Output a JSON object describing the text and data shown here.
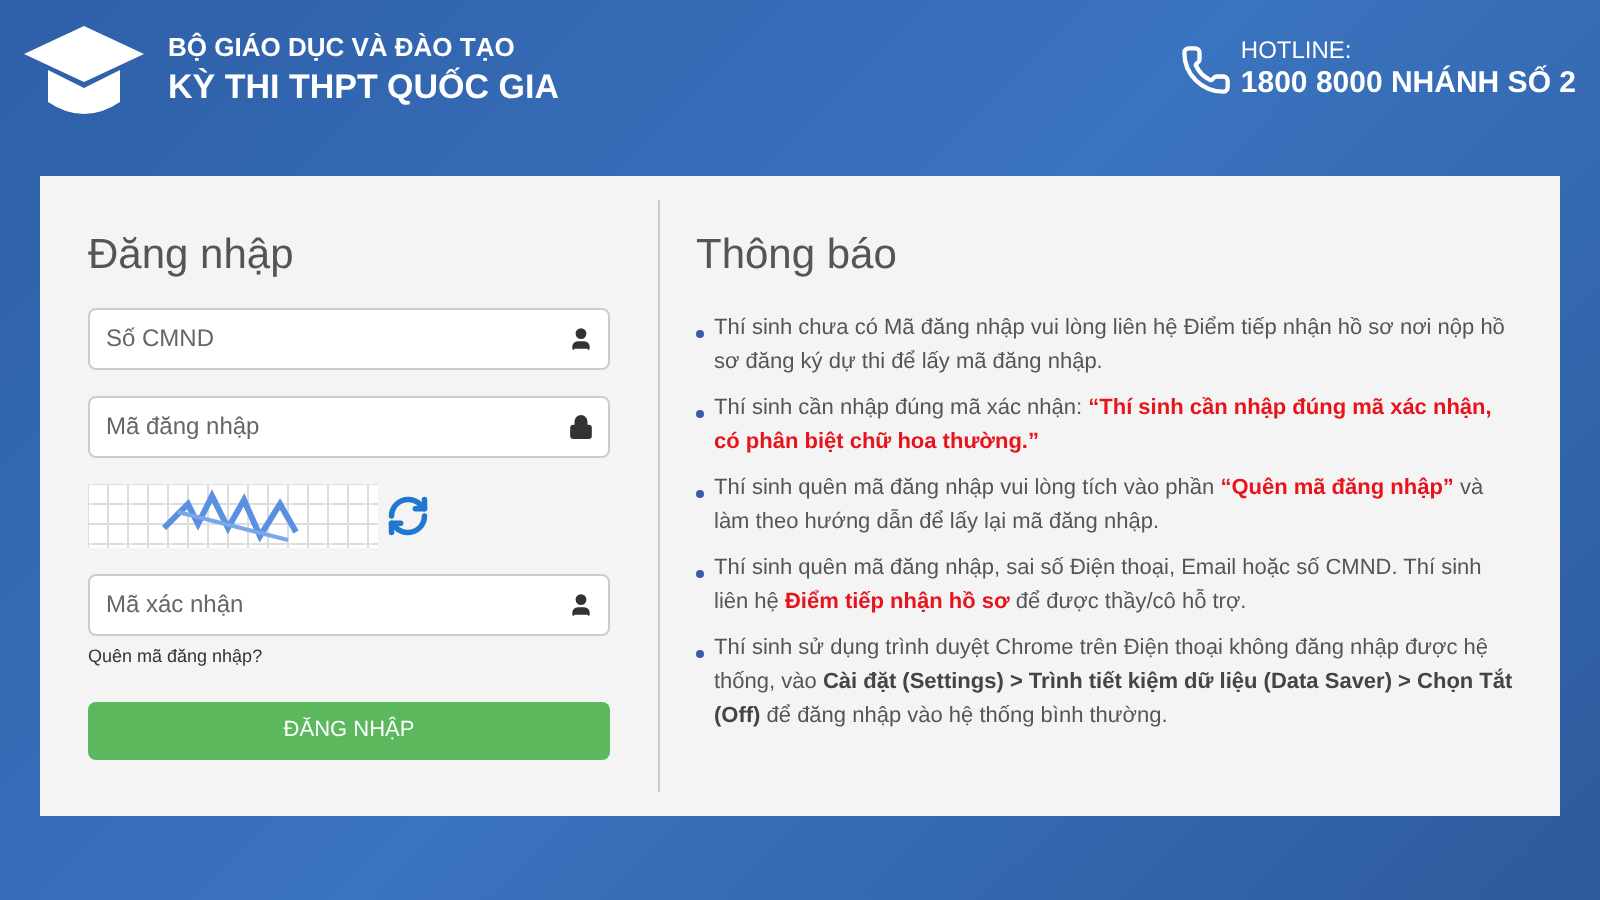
{
  "header": {
    "org": "BỘ GIÁO DỤC VÀ ĐÀO TẠO",
    "title": "KỲ THI THPT QUỐC GIA",
    "hotline_label": "HOTLINE:",
    "hotline_number": "1800 8000 NHÁNH SỐ 2"
  },
  "login": {
    "title": "Đăng nhập",
    "fields": [
      {
        "kind": "account",
        "placeholder": "Số CMND"
      },
      {
        "kind": "password",
        "placeholder": "Mã đăng nhập"
      },
      {
        "kind": "captcha"
      },
      {
        "kind": "account",
        "placeholder": "Mã xác nhận"
      }
    ],
    "forgot_link": "Quên mã đăng nhập?",
    "submit": "ĐĂNG NHẬP"
  },
  "notice": {
    "title": "Thông báo",
    "items": [
      [
        {
          "kind": "plain",
          "text": "Thí sinh chưa có Mã đăng nhập vui lòng liên hệ Điểm tiếp nhận hồ sơ nơi nộp hồ sơ đăng ký dự thi để lấy mã đăng nhập."
        }
      ],
      [
        {
          "kind": "plain",
          "text": "Thí sinh cần nhập đúng mã xác nhận: "
        },
        {
          "kind": "highlight",
          "text": "“Thí sinh cần nhập đúng mã xác nhận, có phân biệt chữ hoa thường.”"
        }
      ],
      [
        {
          "kind": "plain",
          "text": "Thí sinh quên mã đăng nhập vui lòng tích vào phần "
        },
        {
          "kind": "highlight",
          "text": "“Quên mã đăng nhập”"
        },
        {
          "kind": "plain",
          "text": " và làm theo hướng dẫn để lấy lại mã đăng nhập."
        }
      ],
      [
        {
          "kind": "plain",
          "text": "Thí sinh quên mã đăng nhập, sai số Điện thoại, Email hoặc số CMND. Thí sinh liên hệ "
        },
        {
          "kind": "highlight",
          "text": "Điểm tiếp nhận hồ sơ"
        },
        {
          "kind": "plain",
          "text": " để được thầy/cô hỗ trợ."
        }
      ],
      [
        {
          "kind": "plain",
          "text": "Thí sinh sử dụng trình duyệt Chrome trên Điện thoại không đăng nhập được hệ thống, vào "
        },
        {
          "kind": "emphasis",
          "text": "Cài đặt (Settings) > Trình tiết kiệm dữ liệu (Data Saver) > Chọn Tắt (Off)"
        },
        {
          "kind": "plain",
          "text": " để đăng nhập vào hệ thống bình thường."
        }
      ]
    ]
  }
}
